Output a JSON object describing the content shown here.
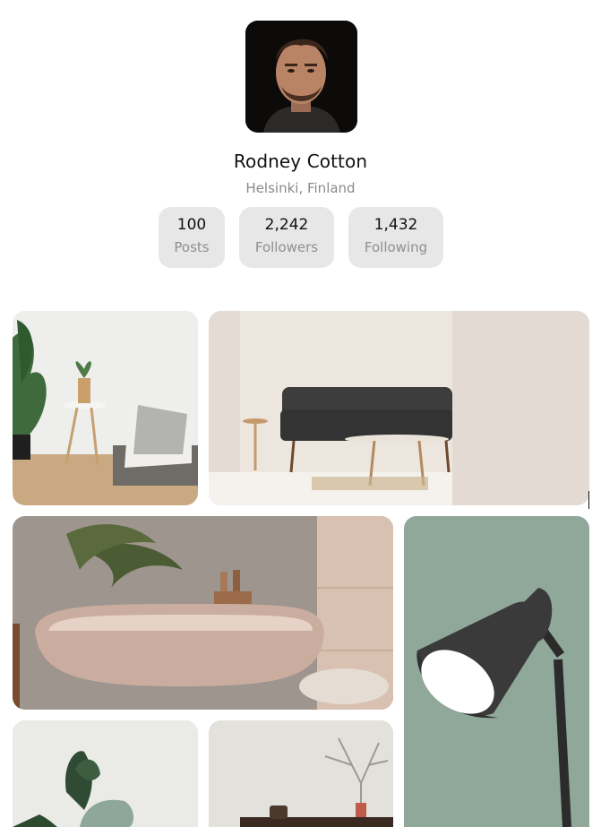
{
  "profile": {
    "name": "Rodney Cotton",
    "location": "Helsinki, Finland"
  },
  "stats": [
    {
      "value": "100",
      "label": "Posts"
    },
    {
      "value": "2,242",
      "label": "Followers"
    },
    {
      "value": "1,432",
      "label": "Following"
    }
  ],
  "gallery": [
    {
      "subject": "plant-side-table-bed"
    },
    {
      "subject": "living-room-sofa"
    },
    {
      "subject": "bathtub"
    },
    {
      "subject": "floor-lamp"
    },
    {
      "subject": "potted-plant"
    },
    {
      "subject": "shelf-decor"
    }
  ]
}
